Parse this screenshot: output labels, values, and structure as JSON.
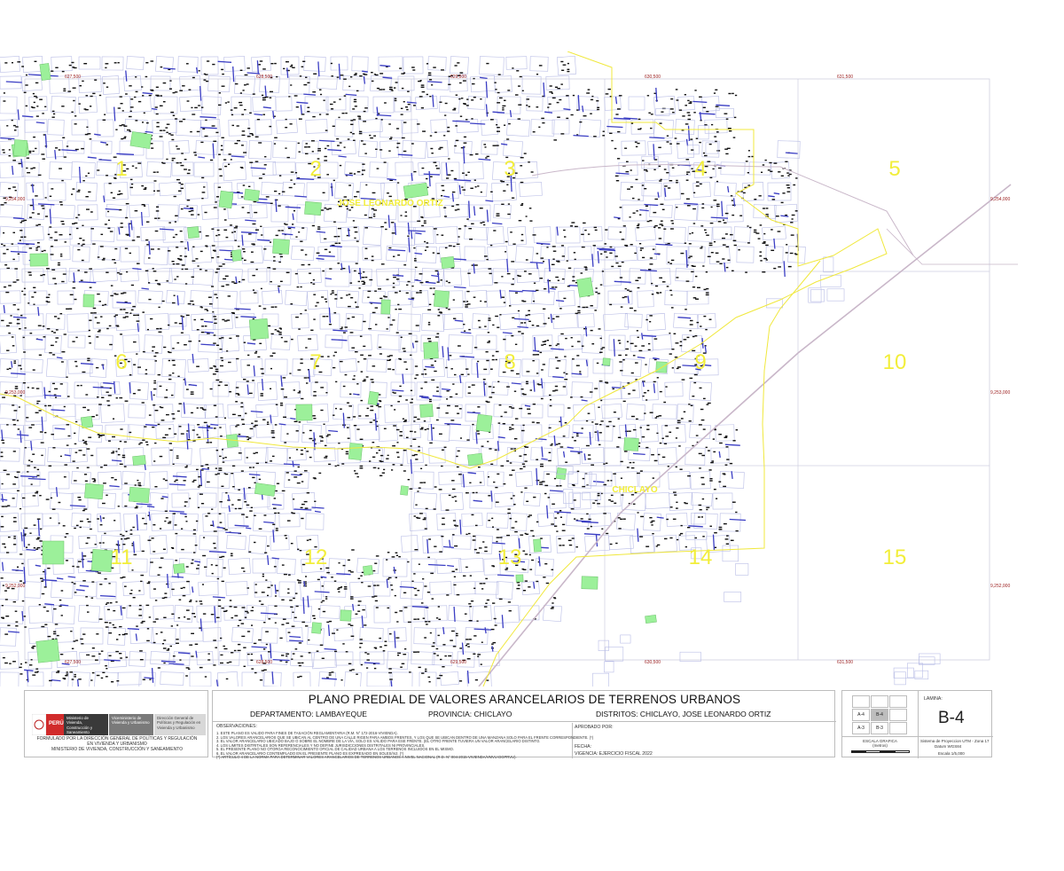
{
  "map": {
    "zones": [
      {
        "label": "1"
      },
      {
        "label": "2"
      },
      {
        "label": "3"
      },
      {
        "label": "4"
      },
      {
        "label": "5"
      },
      {
        "label": "6"
      },
      {
        "label": "7"
      },
      {
        "label": "8"
      },
      {
        "label": "9"
      },
      {
        "label": "10"
      },
      {
        "label": "11"
      },
      {
        "label": "12"
      },
      {
        "label": "13"
      },
      {
        "label": "14"
      },
      {
        "label": "15"
      }
    ],
    "district_labels": [
      "JOSE LEONARDO ORTIZ",
      "CHICLAYO"
    ],
    "easting_labels": [
      "627,500",
      "628,500",
      "629,500",
      "630,500",
      "631,500"
    ],
    "northing_labels": [
      "9,254,000",
      "9,253,000",
      "9,252,000"
    ],
    "colors": {
      "zone_label": "#f2ee3a",
      "district_boundary": "#f0e83c",
      "blocks": "#b9bde6",
      "parks": "#9cf09a",
      "grid": "#cfcfe0",
      "coords": "#9a1c1c",
      "lots": "#111111",
      "streets": "#3b3ec4"
    }
  },
  "titleblock": {
    "logo": {
      "country": "PERÚ",
      "ministry": "Ministerio de Vivienda, Construcción y Saneamiento",
      "vice": "Viceministerio de Vivienda y Urbanismo",
      "direction": "Dirección General de Políticas y Regulación en Vivienda y Urbanismo",
      "formulated_1": "FORMULADO POR LA DIRECCIÓN GENERAL DE POLÍTICAS Y REGULACIÓN",
      "formulated_2": "EN VIVIENDA Y URBANISMO",
      "formulated_3": "MINISTERIO DE VIVIENDA, CONSTRUCCIÓN Y SANEAMIENTO"
    },
    "title": "PLANO PREDIAL DE VALORES ARANCELARIOS DE TERRENOS URBANOS",
    "departamento": "DEPARTAMENTO: LAMBAYEQUE",
    "provincia": "PROVINCIA: CHICLAYO",
    "distritos": "DISTRITOS: CHICLAYO, JOSE LEONARDO ORTIZ",
    "observaciones_title": "OBSERVACIONES:",
    "observaciones": [
      "1. ESTE PLANO ES VALIDO PARA FINES DE TASACIÓN REGLAMENTARIA (R.M. N° 172-2016-VIVIENDA).",
      "2. LOS VALORES ARANCELARIOS QUE SE UBICAN AL CENTRO DE UNA CALLE RIGEN PARA AMBOS FRENTES, Y LOS QUE SE UBICAN DENTRO DE UNA MANZANA SOLO PARA EL FRENTE CORRESPONDIENTE. (*)",
      "3. EL VALOR ARANCELARIO UBICADO BAJO O SOBRE EL NOMBRE DE LA VÍA, SOLO ES VÁLIDO PARA ESE FRENTE. (EL OTRO FRENTE TUVIERA UN VALOR ARANCELARIO DISTINTO.",
      "4. LOS LIMITES DISTRITALES SON REFERENCIALES Y NO DEFINE JURISDICCIONES DISTRITALES NI PROVINCIALES.",
      "5. EL PRESENTE PLANO NO OTORGA RECONOCIMIENTO OFICIAL DE CALIDAD URBANA A LOS TERRENOS INCLUIDOS EN EL MISMO.",
      "6. EL VALOR ARANCELARIO CONTEMPLADO EN EL PRESENTE PLANO ES EXPRESADO EN SOLES/m2. (*)",
      "(*) ARTÍCULO 4 DE LA NORMA PARA DETERMINAR VALORES ARANCELARIOS DE TERRENOS URBANOS A NIVEL NACIONAL (R.D. N° 004-2015-VIVIENDA/VMVU-DGPRVU)."
    ],
    "aprobado": "APROBADO POR:",
    "fecha": "FECHA:",
    "vigencia": "VIGENCIA: EJERCICIO FISCAL 2022",
    "index_cells": [
      "A-4",
      "B-4",
      "A-3",
      "B-3"
    ],
    "lamina_label": "LAMINA:",
    "lamina_value": "B-4",
    "escala_grafica": "ESCALA GRAFICA",
    "escala_metros": "(metros)",
    "sistema": "Sistema de Proyeccion UTM - Zona 17",
    "datum": "Datum WGS84",
    "escala": "Escala 1/5,000"
  }
}
